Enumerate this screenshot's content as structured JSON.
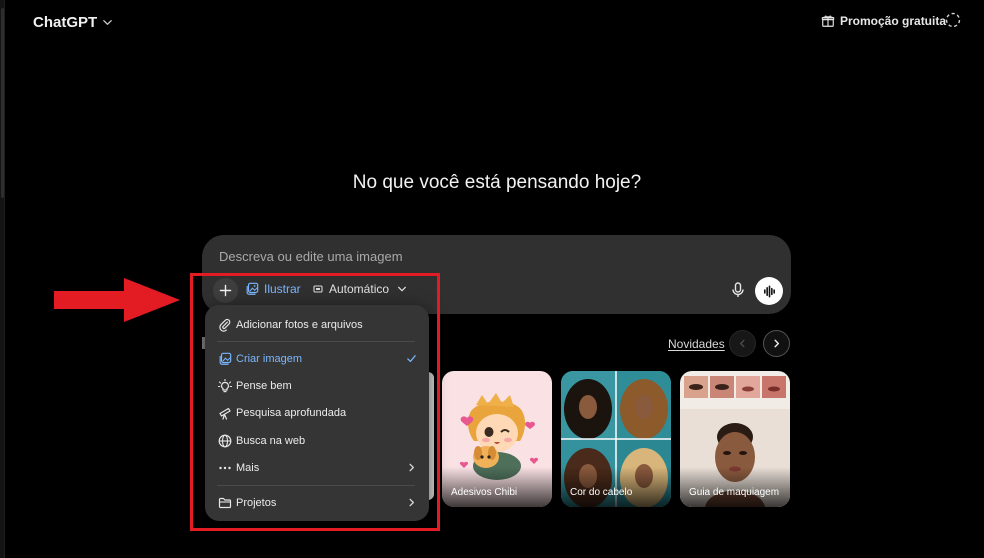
{
  "header": {
    "model_label": "ChatGPT",
    "promo_label": "Promoção gratuita"
  },
  "main": {
    "headline": "No que você está pensando hoje?"
  },
  "composer": {
    "placeholder": "Descreva ou edite uma imagem",
    "active_tool": "Ilustrar",
    "aspect_ratio": "Automático"
  },
  "tools_menu": {
    "items": [
      {
        "label": "Adicionar fotos e arquivos",
        "icon": "paperclip-icon"
      },
      {
        "label": "Criar imagem",
        "icon": "image-icon",
        "selected": true
      },
      {
        "label": "Pense bem",
        "icon": "lightbulb-icon"
      },
      {
        "label": "Pesquisa aprofundada",
        "icon": "telescope-icon"
      },
      {
        "label": "Busca na web",
        "icon": "globe-icon"
      },
      {
        "label": "Mais",
        "icon": "ellipsis-icon",
        "submenu": true
      },
      {
        "label": "Projetos",
        "icon": "folder-icon",
        "submenu": true
      }
    ]
  },
  "carousel": {
    "heading_link": "Novidades",
    "cards": [
      {
        "caption": "Adesivos Chibi"
      },
      {
        "caption": "Cor do cabelo"
      },
      {
        "caption": "Guia de maquiagem"
      }
    ]
  },
  "colors": {
    "background": "#000000",
    "composer_bg": "#303030",
    "menu_bg": "#353535",
    "accent_blue": "#7ab7ff",
    "annotation_red": "#e31b23"
  }
}
